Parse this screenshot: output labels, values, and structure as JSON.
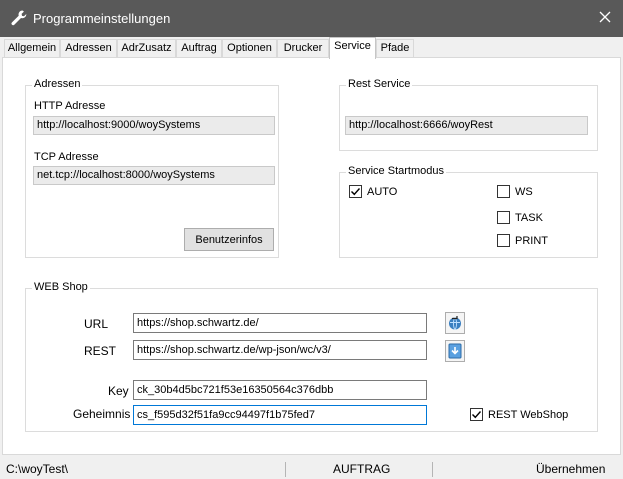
{
  "window": {
    "title": "Programmeinstellungen"
  },
  "tabs": [
    {
      "label": "Allgemein"
    },
    {
      "label": "Adressen"
    },
    {
      "label": "AdrZusatz"
    },
    {
      "label": "Auftrag"
    },
    {
      "label": "Optionen"
    },
    {
      "label": "Drucker"
    },
    {
      "label": "Service"
    },
    {
      "label": "Pfade"
    }
  ],
  "active_tab": "Service",
  "adressen": {
    "title": "Adressen",
    "http_label": "HTTP Adresse",
    "http_value": "http://localhost:9000/woySystems",
    "tcp_label": "TCP Adresse",
    "tcp_value": "net.tcp://localhost:8000/woySystems",
    "button_label": "Benutzerinfos"
  },
  "rest_service": {
    "title": "Rest Service",
    "value": "http://localhost:6666/woyRest"
  },
  "startmodus": {
    "title": "Service Startmodus",
    "options": [
      {
        "label": "AUTO",
        "checked": true
      },
      {
        "label": "WS",
        "checked": false
      },
      {
        "label": "TASK",
        "checked": false
      },
      {
        "label": "PRINT",
        "checked": false
      }
    ]
  },
  "webshop": {
    "title": "WEB Shop",
    "url_label": "URL",
    "url_value": "https://shop.schwartz.de/",
    "rest_label": "REST",
    "rest_value": "https://shop.schwartz.de/wp-json/wc/v3/",
    "key_label": "Key",
    "key_value": "ck_30b4d5bc721f53e16350564c376dbb",
    "secret_label": "Geheimnis",
    "secret_value": "cs_f595d32f51fa9cc94497f1b75fed7",
    "rest_webshop_label": "REST WebShop",
    "rest_webshop_checked": true
  },
  "statusbar": {
    "path": "C:\\woyTest\\",
    "mode": "AUFTRAG",
    "action": "Übernehmen"
  },
  "colors": {
    "titlebar": "#595959",
    "focus_border": "#0078d7",
    "readonly_bg": "#ebebeb"
  },
  "icons": {
    "title": "wrench-icon",
    "close": "close-icon",
    "url_button": "globe-link-icon",
    "rest_button": "download-icon",
    "checkmark": "checkmark-icon"
  }
}
